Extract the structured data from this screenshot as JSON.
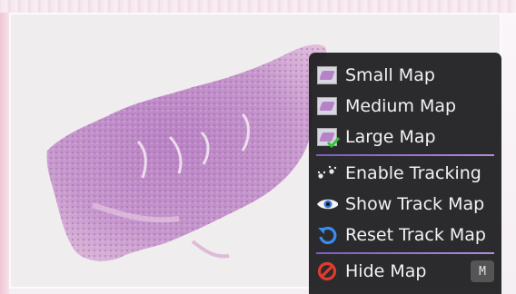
{
  "menu": {
    "items": [
      {
        "label": "Small Map",
        "icon": "small-map-icon"
      },
      {
        "label": "Medium Map",
        "icon": "medium-map-icon"
      },
      {
        "label": "Large Map",
        "icon": "large-map-check-icon"
      },
      {
        "label": "Enable Tracking",
        "icon": "paw-tracking-icon"
      },
      {
        "label": "Show Track Map",
        "icon": "eye-icon"
      },
      {
        "label": "Reset Track Map",
        "icon": "reset-icon"
      },
      {
        "label": "Hide Map",
        "icon": "no-symbol-icon",
        "shortcut": "M"
      }
    ]
  },
  "colors": {
    "tissue": "#c391c7",
    "menu_bg": "#1c1c1e",
    "separator": "#9a73d6"
  }
}
